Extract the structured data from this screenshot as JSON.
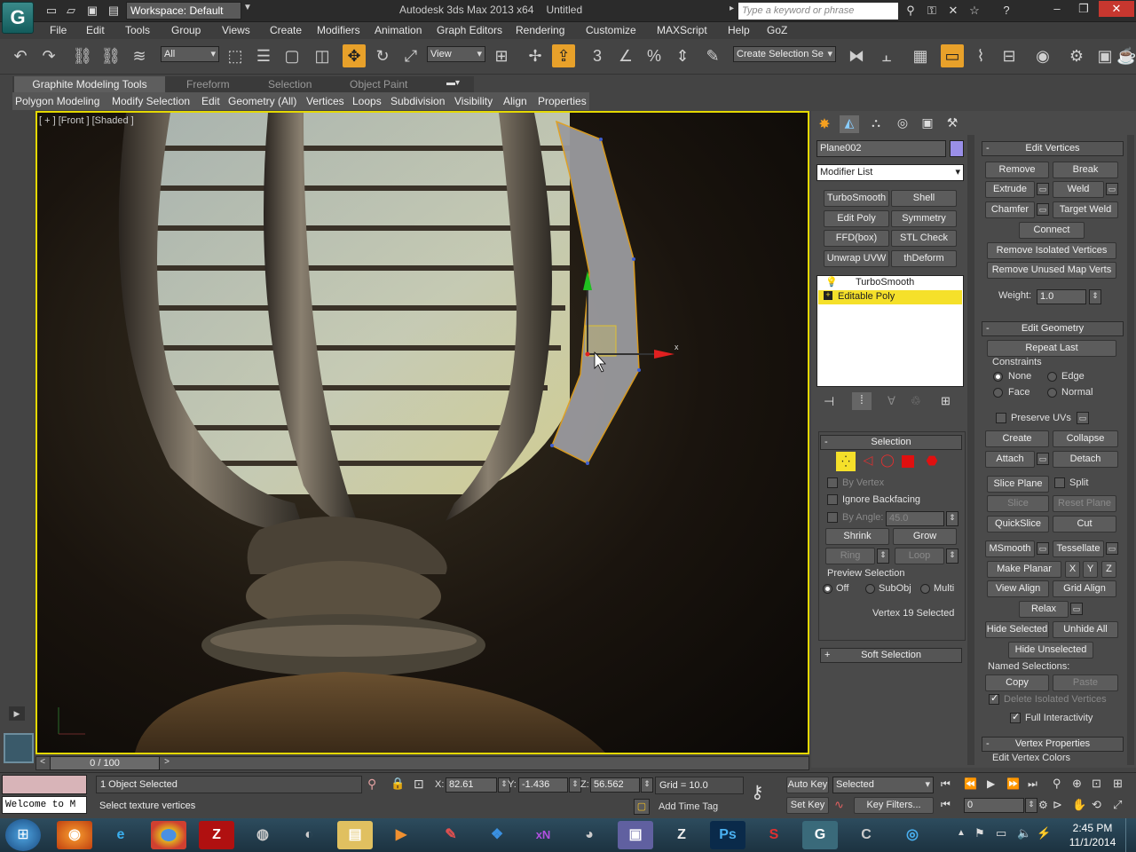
{
  "window": {
    "title": "Autodesk 3ds Max 2013 x64",
    "file": "Untitled",
    "workspace": "Workspace: Default",
    "search_placeholder": "Type a keyword or phrase"
  },
  "menu": [
    "File",
    "Edit",
    "Tools",
    "Group",
    "Views",
    "Create",
    "Modifiers",
    "Animation",
    "Graph Editors",
    "Rendering",
    "Customize",
    "MAXScript",
    "Help",
    "GoZ"
  ],
  "toolbar": {
    "filter": "All",
    "ref_coord": "View",
    "selection_set_placeholder": "Create Selection Se"
  },
  "ribbon": {
    "tabs": [
      "Graphite Modeling Tools",
      "Freeform",
      "Selection",
      "Object Paint"
    ],
    "panels": [
      "Polygon Modeling",
      "Modify Selection",
      "Edit",
      "Geometry (All)",
      "Vertices",
      "Loops",
      "Subdivision",
      "Visibility",
      "Align",
      "Properties"
    ]
  },
  "viewport": {
    "label": "[ + ] [Front ] [Shaded ]",
    "gizmo_x": "x"
  },
  "modify": {
    "object_name": "Plane002",
    "modifier_list": "Modifier List",
    "modifier_buttons": [
      "TurboSmooth",
      "Shell",
      "Edit Poly",
      "Symmetry",
      "FFD(box)",
      "STL Check",
      "Unwrap UVW",
      "thDeform (WSI"
    ],
    "stack": [
      "TurboSmooth",
      "Editable Poly"
    ]
  },
  "selection": {
    "header": "Selection",
    "by_vertex": "By Vertex",
    "ignore_backfacing": "Ignore Backfacing",
    "by_angle": "By Angle:",
    "angle_value": "45.0",
    "shrink": "Shrink",
    "grow": "Grow",
    "ring": "Ring",
    "loop": "Loop",
    "preview_label": "Preview Selection",
    "preview_off": "Off",
    "preview_subobj": "SubObj",
    "preview_multi": "Multi",
    "status": "Vertex 19 Selected",
    "soft_selection": "Soft Selection"
  },
  "edit_vertices": {
    "header": "Edit Vertices",
    "remove": "Remove",
    "break": "Break",
    "extrude": "Extrude",
    "weld": "Weld",
    "chamfer": "Chamfer",
    "target_weld": "Target Weld",
    "connect": "Connect",
    "remove_isolated": "Remove Isolated Vertices",
    "remove_unused": "Remove Unused Map Verts",
    "weight_label": "Weight:",
    "weight_value": "1.0"
  },
  "edit_geometry": {
    "header": "Edit Geometry",
    "repeat_last": "Repeat Last",
    "constraints": "Constraints",
    "c_none": "None",
    "c_edge": "Edge",
    "c_face": "Face",
    "c_normal": "Normal",
    "preserve_uvs": "Preserve UVs",
    "create": "Create",
    "collapse": "Collapse",
    "attach": "Attach",
    "detach": "Detach",
    "slice_plane": "Slice Plane",
    "split": "Split",
    "slice": "Slice",
    "reset_plane": "Reset Plane",
    "quickslice": "QuickSlice",
    "cut": "Cut",
    "msmooth": "MSmooth",
    "tessellate": "Tessellate",
    "make_planar": "Make Planar",
    "x": "X",
    "y": "Y",
    "z": "Z",
    "view_align": "View Align",
    "grid_align": "Grid Align",
    "relax": "Relax",
    "hide_selected": "Hide Selected",
    "unhide_all": "Unhide All",
    "hide_unselected": "Hide Unselected",
    "named_selections": "Named Selections:",
    "copy": "Copy",
    "paste": "Paste",
    "delete_isolated": "Delete Isolated Vertices",
    "full_interactivity": "Full Interactivity"
  },
  "vertex_properties": {
    "header": "Vertex Properties",
    "edit_colors": "Edit Vertex Colors"
  },
  "timeline": {
    "frame": "0 / 100"
  },
  "status": {
    "objects": "1 Object Selected",
    "prompt": "Select texture vertices",
    "listener": "Welcome to M",
    "x_label": "X:",
    "x": "82.61",
    "y_label": "Y:",
    "y": "-1.436",
    "z_label": "Z:",
    "z": "56.562",
    "grid": "Grid = 10.0",
    "auto_key": "Auto Key",
    "set_key": "Set Key",
    "key_mode": "Selected",
    "key_filters": "Key Filters...",
    "add_time_tag": "Add Time Tag",
    "frame_field": "0"
  },
  "taskbar": {
    "time": "2:45 PM",
    "date": "11/1/2014",
    "apps": [
      "firefox",
      "internet-explorer",
      "chrome",
      "filezilla",
      "app",
      "app",
      "explorer",
      "media-player",
      "paint",
      "dropbox",
      "xn",
      "app",
      "app",
      "zbrush",
      "photoshop",
      "app",
      "3dsmax",
      "app",
      "app"
    ]
  },
  "colors": {
    "selected_yellow": "#f5e02a",
    "viewport_border": "#e4d800",
    "accent": "#e8a12a",
    "object_color": "#9a8fe8"
  }
}
